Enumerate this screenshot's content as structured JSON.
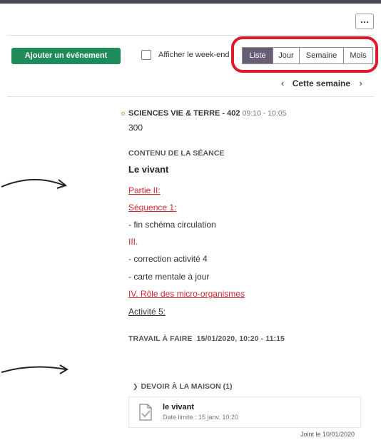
{
  "toolbar": {
    "more_label": "…",
    "add_event_label": "Ajouter un événement",
    "show_weekend_label": "Afficher le week-end",
    "show_weekend_checked": false,
    "views": [
      {
        "label": "Liste",
        "active": true
      },
      {
        "label": "Jour",
        "active": false
      },
      {
        "label": "Semaine",
        "active": false
      },
      {
        "label": "Mois",
        "active": false
      }
    ],
    "week_label": "Cette semaine",
    "prev_icon": "chevron-left-icon",
    "next_icon": "chevron-right-icon"
  },
  "session": {
    "course": "SCIENCES VIE & TERRE - 402",
    "time": "09:10 - 10:05",
    "room": "300",
    "content_header": "CONTENU DE LA SÉANCE",
    "subject": "Le vivant",
    "lines": [
      {
        "text": "Partie II:",
        "style": "red-underline"
      },
      {
        "text": "Séquence 1:",
        "style": "red-underline"
      },
      {
        "text": "- fin schéma circulation",
        "style": "plain"
      },
      {
        "text": "III.",
        "style": "red"
      },
      {
        "text": "- correction activité 4",
        "style": "plain"
      },
      {
        "text": "- carte mentale à jour",
        "style": "plain"
      },
      {
        "text": "IV. Rôle des micro-organismes",
        "style": "red-underline"
      },
      {
        "text": "Activité 5:",
        "style": "underline"
      }
    ]
  },
  "homework": {
    "header": "TRAVAIL À FAIRE",
    "datetime": "15/01/2020, 10:20 - 11:15",
    "section_label": "DEVOIR À LA MAISON (1)",
    "item": {
      "title": "le vivant",
      "due": "Date limite : 15 janv. 10:20",
      "icon": "document-check-icon"
    },
    "joined": "Joint le 10/01/2020"
  },
  "colors": {
    "accent_green": "#1f8a5a",
    "active_view": "#675e74",
    "highlight_red": "#e0182b",
    "link_red": "#d32530"
  }
}
